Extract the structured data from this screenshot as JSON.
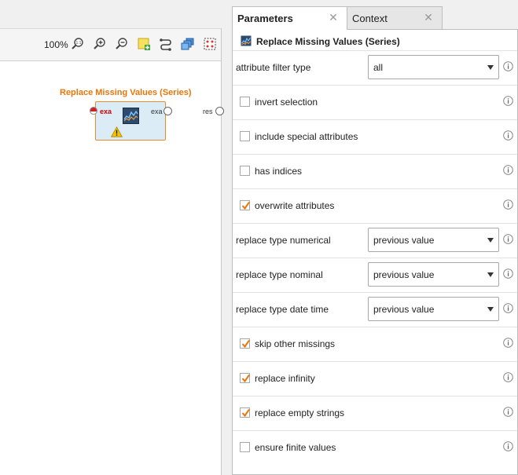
{
  "canvas": {
    "zoom_label": "100%",
    "operator": {
      "title": "Replace Missing Values (Series)",
      "input_port": "exa",
      "output_port": "exa"
    },
    "result_port": "res"
  },
  "tabs": [
    {
      "label": "Parameters",
      "active": true
    },
    {
      "label": "Context",
      "active": false
    }
  ],
  "panel": {
    "header": "Replace Missing Values (Series)",
    "params": [
      {
        "type": "select",
        "label": "attribute filter type",
        "value": "all"
      },
      {
        "type": "checkbox",
        "label": "invert selection",
        "checked": false
      },
      {
        "type": "checkbox",
        "label": "include special attributes",
        "checked": false
      },
      {
        "type": "checkbox",
        "label": "has indices",
        "checked": false
      },
      {
        "type": "checkbox",
        "label": "overwrite attributes",
        "checked": true
      },
      {
        "type": "select",
        "label": "replace type numerical",
        "value": "previous value"
      },
      {
        "type": "select",
        "label": "replace type nominal",
        "value": "previous value"
      },
      {
        "type": "select",
        "label": "replace type date time",
        "value": "previous value"
      },
      {
        "type": "checkbox",
        "label": "skip other missings",
        "checked": true
      },
      {
        "type": "checkbox",
        "label": "replace infinity",
        "checked": true
      },
      {
        "type": "checkbox",
        "label": "replace empty strings",
        "checked": true
      },
      {
        "type": "checkbox",
        "label": "ensure finite values",
        "checked": false
      }
    ]
  },
  "colors": {
    "accent": "#e8760a",
    "check": "#e8760a",
    "port_red": "#d10000"
  }
}
